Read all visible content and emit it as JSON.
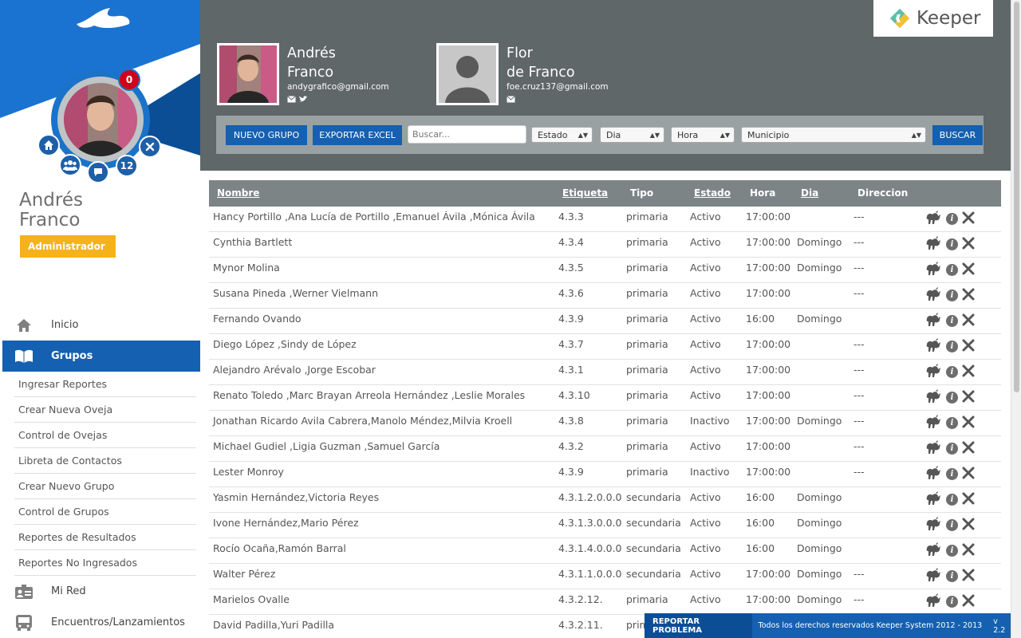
{
  "sidebar": {
    "user": {
      "first_name": "Andrés",
      "last_name": "Franco",
      "role": "Administrador"
    },
    "notifications_count": "0",
    "members_count": "12",
    "nav": [
      {
        "label": "Inicio",
        "icon": "home-icon"
      },
      {
        "label": "Grupos",
        "icon": "book-icon",
        "active": true
      }
    ],
    "subnav": [
      "Ingresar Reportes",
      "Crear Nueva Oveja",
      "Control de Ovejas",
      "Libreta de Contactos",
      "Crear Nuevo Grupo",
      "Control de Grupos",
      "Reportes de Resultados",
      "Reportes No Ingresados"
    ],
    "nav_bottom": [
      {
        "label": "Mi Red",
        "icon": "id-card-icon"
      },
      {
        "label": "Encuentros/Lanzamientos",
        "icon": "bus-icon"
      }
    ]
  },
  "header": {
    "logo_text": "Keeper",
    "profiles": [
      {
        "name_line1": "Andrés",
        "name_line2": "Franco",
        "email": "andygrafico@gmail.com"
      },
      {
        "name_line1": "Flor",
        "name_line2": "de Franco",
        "email": "foe.cruz137@gmail.com"
      }
    ],
    "toolbar": {
      "new_group": "NUEVO GRUPO",
      "export_excel": "EXPORTAR EXCEL",
      "search_placeholder": "Buscar...",
      "estado": "Estado",
      "dia": "Dia",
      "hora": "Hora",
      "municipio": "Municipio",
      "search_button": "BUSCAR"
    }
  },
  "table": {
    "columns": {
      "nombre": "Nombre",
      "etiqueta": "Etiqueta",
      "tipo": "Tipo",
      "estado": "Estado",
      "hora": "Hora",
      "dia": "Dia",
      "direccion": "Direccion"
    },
    "rows": [
      {
        "nombre": "Hancy Portillo ,Ana Lucía de Portillo ,Emanuel Ávila ,Mónica Ávila",
        "etiqueta": "4.3.3",
        "tipo": "primaria",
        "estado": "Activo",
        "hora": "17:00:00",
        "dia": "",
        "direccion": "---"
      },
      {
        "nombre": "Cynthia Bartlett",
        "etiqueta": "4.3.4",
        "tipo": "primaria",
        "estado": "Activo",
        "hora": "17:00:00",
        "dia": "Domingo",
        "direccion": "---"
      },
      {
        "nombre": "Mynor Molina",
        "etiqueta": "4.3.5",
        "tipo": "primaria",
        "estado": "Activo",
        "hora": "17:00:00",
        "dia": "Domingo",
        "direccion": "---"
      },
      {
        "nombre": "Susana Pineda ,Werner Vielmann",
        "etiqueta": "4.3.6",
        "tipo": "primaria",
        "estado": "Activo",
        "hora": "17:00:00",
        "dia": "",
        "direccion": "---"
      },
      {
        "nombre": "Fernando Ovando",
        "etiqueta": "4.3.9",
        "tipo": "primaria",
        "estado": "Activo",
        "hora": "16:00",
        "dia": "Domingo",
        "direccion": ""
      },
      {
        "nombre": "Diego López ,Sindy de López",
        "etiqueta": "4.3.7",
        "tipo": "primaria",
        "estado": "Activo",
        "hora": "17:00:00",
        "dia": "",
        "direccion": "---"
      },
      {
        "nombre": "Alejandro Arévalo ,Jorge Escobar",
        "etiqueta": "4.3.1",
        "tipo": "primaria",
        "estado": "Activo",
        "hora": "17:00:00",
        "dia": "",
        "direccion": "---"
      },
      {
        "nombre": "Renato Toledo ,Marc Brayan Arreola Hernández ,Leslie Morales",
        "etiqueta": "4.3.10",
        "tipo": "primaria",
        "estado": "Activo",
        "hora": "17:00:00",
        "dia": "",
        "direccion": "---"
      },
      {
        "nombre": "Jonathan Ricardo Avila Cabrera,Manolo Méndez,Milvia Kroell",
        "etiqueta": "4.3.8",
        "tipo": "primaria",
        "estado": "Inactivo",
        "hora": "17:00:00",
        "dia": "Domingo",
        "direccion": "---"
      },
      {
        "nombre": "Michael Gudiel ,Ligia Guzman ,Samuel García",
        "etiqueta": "4.3.2",
        "tipo": "primaria",
        "estado": "Activo",
        "hora": "17:00:00",
        "dia": "",
        "direccion": "---"
      },
      {
        "nombre": "Lester Monroy",
        "etiqueta": "4.3.9",
        "tipo": "primaria",
        "estado": "Inactivo",
        "hora": "17:00:00",
        "dia": "",
        "direccion": "---"
      },
      {
        "nombre": "Yasmin Hernández,Victoria Reyes",
        "etiqueta": "4.3.1.2.0.0.0",
        "tipo": "secundaria",
        "estado": "Activo",
        "hora": "16:00",
        "dia": "Domingo",
        "direccion": ""
      },
      {
        "nombre": "Ivone Hernández,Mario Pérez",
        "etiqueta": "4.3.1.3.0.0.0",
        "tipo": "secundaria",
        "estado": "Activo",
        "hora": "16:00",
        "dia": "Domingo",
        "direccion": ""
      },
      {
        "nombre": "Rocío Ocaña,Ramón Barral",
        "etiqueta": "4.3.1.4.0.0.0",
        "tipo": "secundaria",
        "estado": "Activo",
        "hora": "16:00",
        "dia": "Domingo",
        "direccion": ""
      },
      {
        "nombre": "Walter Pérez",
        "etiqueta": "4.3.1.1.0.0.0",
        "tipo": "secundaria",
        "estado": "Activo",
        "hora": "17:00:00",
        "dia": "Domingo",
        "direccion": "---"
      },
      {
        "nombre": "Marielos Ovalle",
        "etiqueta": "4.3.2.12.",
        "tipo": "primaria",
        "estado": "Activo",
        "hora": "17:00:00",
        "dia": "Domingo",
        "direccion": "---"
      },
      {
        "nombre": "David Padilla,Yuri Padilla",
        "etiqueta": "4.3.2.11.",
        "tipo": "primaria",
        "estado": "",
        "hora": "",
        "dia": "",
        "direccion": ""
      }
    ]
  },
  "footer": {
    "report_button": "REPORTAR PROBLEMA",
    "copyright": "Todos los derechos reservados Keeper System 2012 - 2013",
    "version": "v 2.2"
  },
  "colors": {
    "primary_blue": "#1560b0",
    "header_gray": "#5f6769",
    "table_head": "#7d8486",
    "role_badge": "#f5b21b",
    "alert_red": "#d0021b"
  }
}
